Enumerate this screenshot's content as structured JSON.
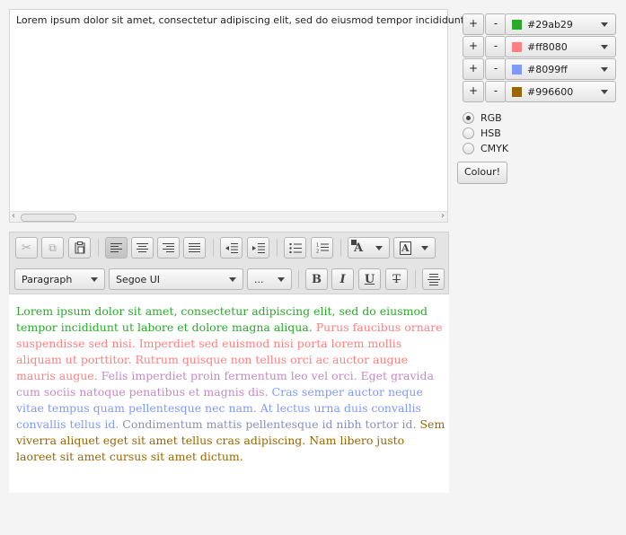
{
  "top_editor": {
    "text": "Lorem ipsum dolor sit amet, consectetur adipiscing elit, sed do eiusmod tempor incididunt"
  },
  "toolbar": {
    "paragraph_select": "Paragraph",
    "font_select": "Segoe UI",
    "size_select": "...",
    "bold": "B",
    "italic": "I",
    "underline": "U",
    "strike": "T",
    "text_color": "A",
    "background_color": "A"
  },
  "editor": {
    "segments": [
      {
        "text": "Lorem ipsum dolor sit amet, consectetur adipiscing elit, sed do eiusmod tempor incididunt ut labore et dolore magna aliqua. ",
        "color": "#29ab29"
      },
      {
        "text": "Purus faucibus ornare suspendisse sed nisi. Imperdiet sed euismod nisi porta lorem mollis aliquam ut porttitor. Rutrum quisque non tellus orci ac auctor augue mauris augue. ",
        "color": "#ff8080"
      },
      {
        "text": "Felis imperdiet proin fermentum leo vel orci. Eget gravida cum sociis natoque penatibus et magnis dis. ",
        "color": "#c58ac4"
      },
      {
        "text": "Cras semper auctor neque vitae tempus quam pellentesque nec nam. At lectus urna duis convallis convallis tellus id. ",
        "color": "#8099ff"
      },
      {
        "text": "Condimentum mattis pellentesque id nibh tortor id. ",
        "color": "#8a8fbd"
      },
      {
        "text": "Sem viverra aliquet eget sit amet tellus cras adipiscing. Nam libero justo laoreet sit amet cursus sit amet dictum.",
        "color": "#996600"
      }
    ]
  },
  "colors": [
    {
      "plus": "+",
      "minus": "-",
      "value": "#29ab29",
      "swatch": "#29ab29"
    },
    {
      "plus": "+",
      "minus": "-",
      "value": "#ff8080",
      "swatch": "#ff8080"
    },
    {
      "plus": "+",
      "minus": "-",
      "value": "#8099ff",
      "swatch": "#8099ff"
    },
    {
      "plus": "+",
      "minus": "-",
      "value": "#996600",
      "swatch": "#996600"
    }
  ],
  "color_modes": [
    {
      "label": "RGB",
      "selected": true
    },
    {
      "label": "HSB",
      "selected": false
    },
    {
      "label": "CMYK",
      "selected": false
    }
  ],
  "colour_button": "Colour!"
}
